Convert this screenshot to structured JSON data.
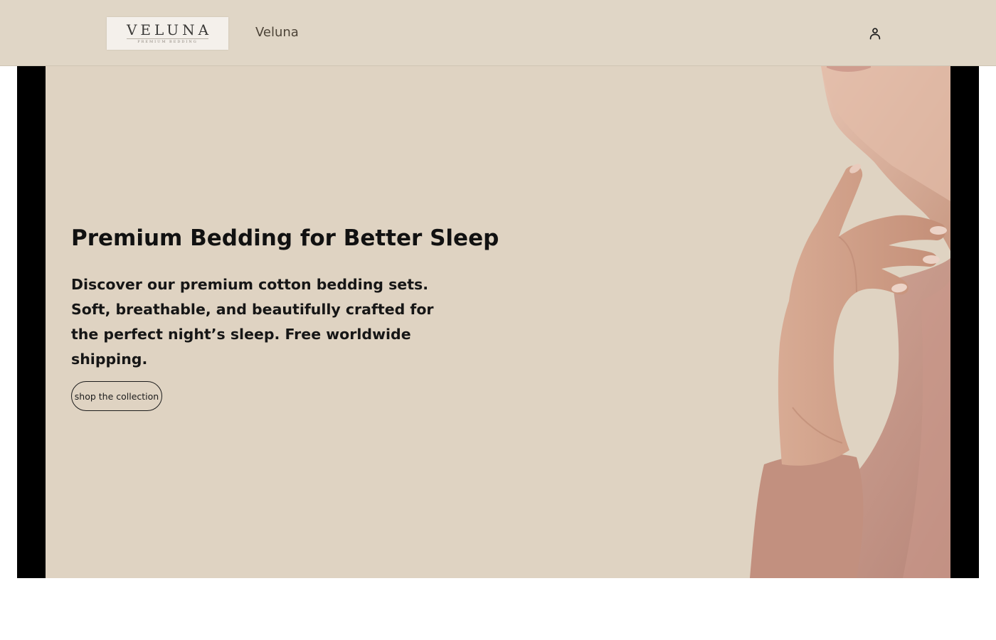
{
  "header": {
    "logo": {
      "wordmark": "VELUNA",
      "tagline": "PREMIUM BEDDING"
    },
    "brand_name": "Veluna",
    "account_icon": "user-icon"
  },
  "hero": {
    "title": "Premium Bedding for Better Sleep",
    "description": "Discover our premium cotton bedding sets. Soft, breathable, and beautifully crafted for the perfect night’s sleep. Free worldwide shipping.",
    "cta_label": "shop the collection",
    "image": "woman-touching-neck-photo"
  },
  "colors": {
    "header_bg": "#e0d6c6",
    "hero_bg": "#dfd3c2",
    "frame": "#000000",
    "text": "#111111"
  }
}
